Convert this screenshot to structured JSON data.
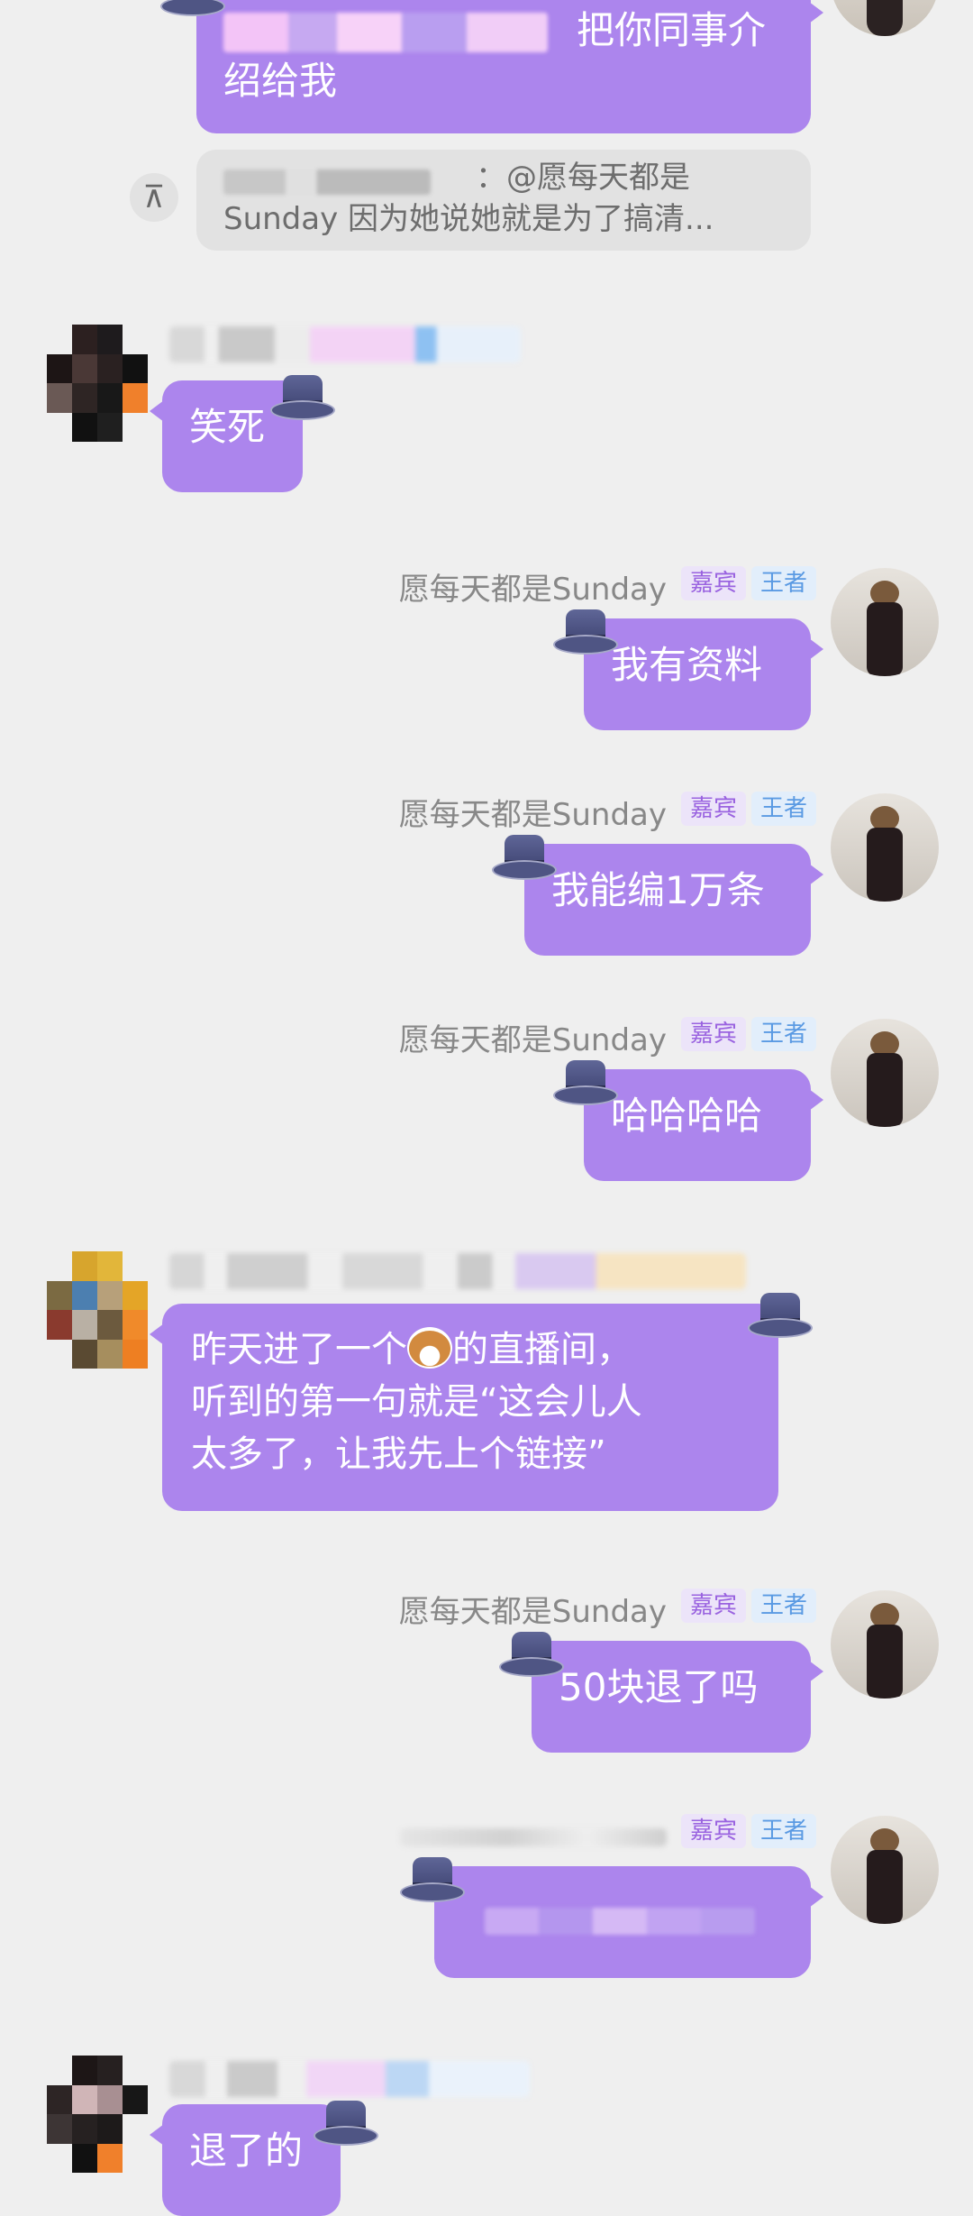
{
  "colors": {
    "bubble": "#ac85ed",
    "background": "#efefef",
    "badge_guest_text": "#9a63e0",
    "badge_king_text": "#5a9ae3"
  },
  "top_message": {
    "text_visible": "把你同事介",
    "text_line2": "绍给我"
  },
  "quote": {
    "line1": "：@愿每天都是",
    "line2": "Sunday 因为她说她就是为了搞清..."
  },
  "self_user": {
    "name": "愿每天都是Sunday",
    "badge_guest": "嘉宾",
    "badge_king": "王者"
  },
  "messages": [
    {
      "side": "left",
      "text": "笑死"
    },
    {
      "side": "right",
      "text": "我有资料"
    },
    {
      "side": "right",
      "text": "我能编1万条"
    },
    {
      "side": "right",
      "text": "哈哈哈哈"
    },
    {
      "side": "left",
      "line1": "昨天进了一个",
      "line1b": "的直播间，",
      "line2": "听到的第一句就是“这会儿人",
      "line3": "太多了，让我先上个链接”"
    },
    {
      "side": "right",
      "text": "50块退了吗"
    },
    {
      "side": "right",
      "text": ""
    },
    {
      "side": "left",
      "text": "退了的"
    }
  ],
  "icons": {
    "quote_icon": "pin-top-icon",
    "hat_icon": "top-hat-icon",
    "dog_icon": "dog-face-icon"
  }
}
